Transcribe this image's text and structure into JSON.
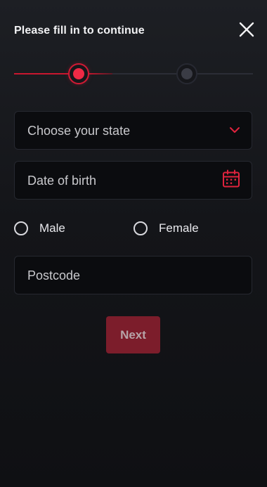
{
  "header": {
    "title": "Please fill in to continue",
    "close_icon": "close-icon"
  },
  "stepper": {
    "current_step": 1,
    "total_steps": 2,
    "active_color": "#ef2a45",
    "inactive_color": "#3a3c45"
  },
  "form": {
    "state": {
      "placeholder": "Choose your state",
      "icon": "chevron-down-icon"
    },
    "dob": {
      "placeholder": "Date of birth",
      "icon": "calendar-icon"
    },
    "gender": {
      "options": [
        "Male",
        "Female"
      ],
      "selected": null
    },
    "postcode": {
      "placeholder": "Postcode"
    },
    "next_label": "Next"
  },
  "colors": {
    "accent": "#d11a34",
    "button_bg": "#7c1d2b",
    "field_bg": "#0b0c0f"
  }
}
